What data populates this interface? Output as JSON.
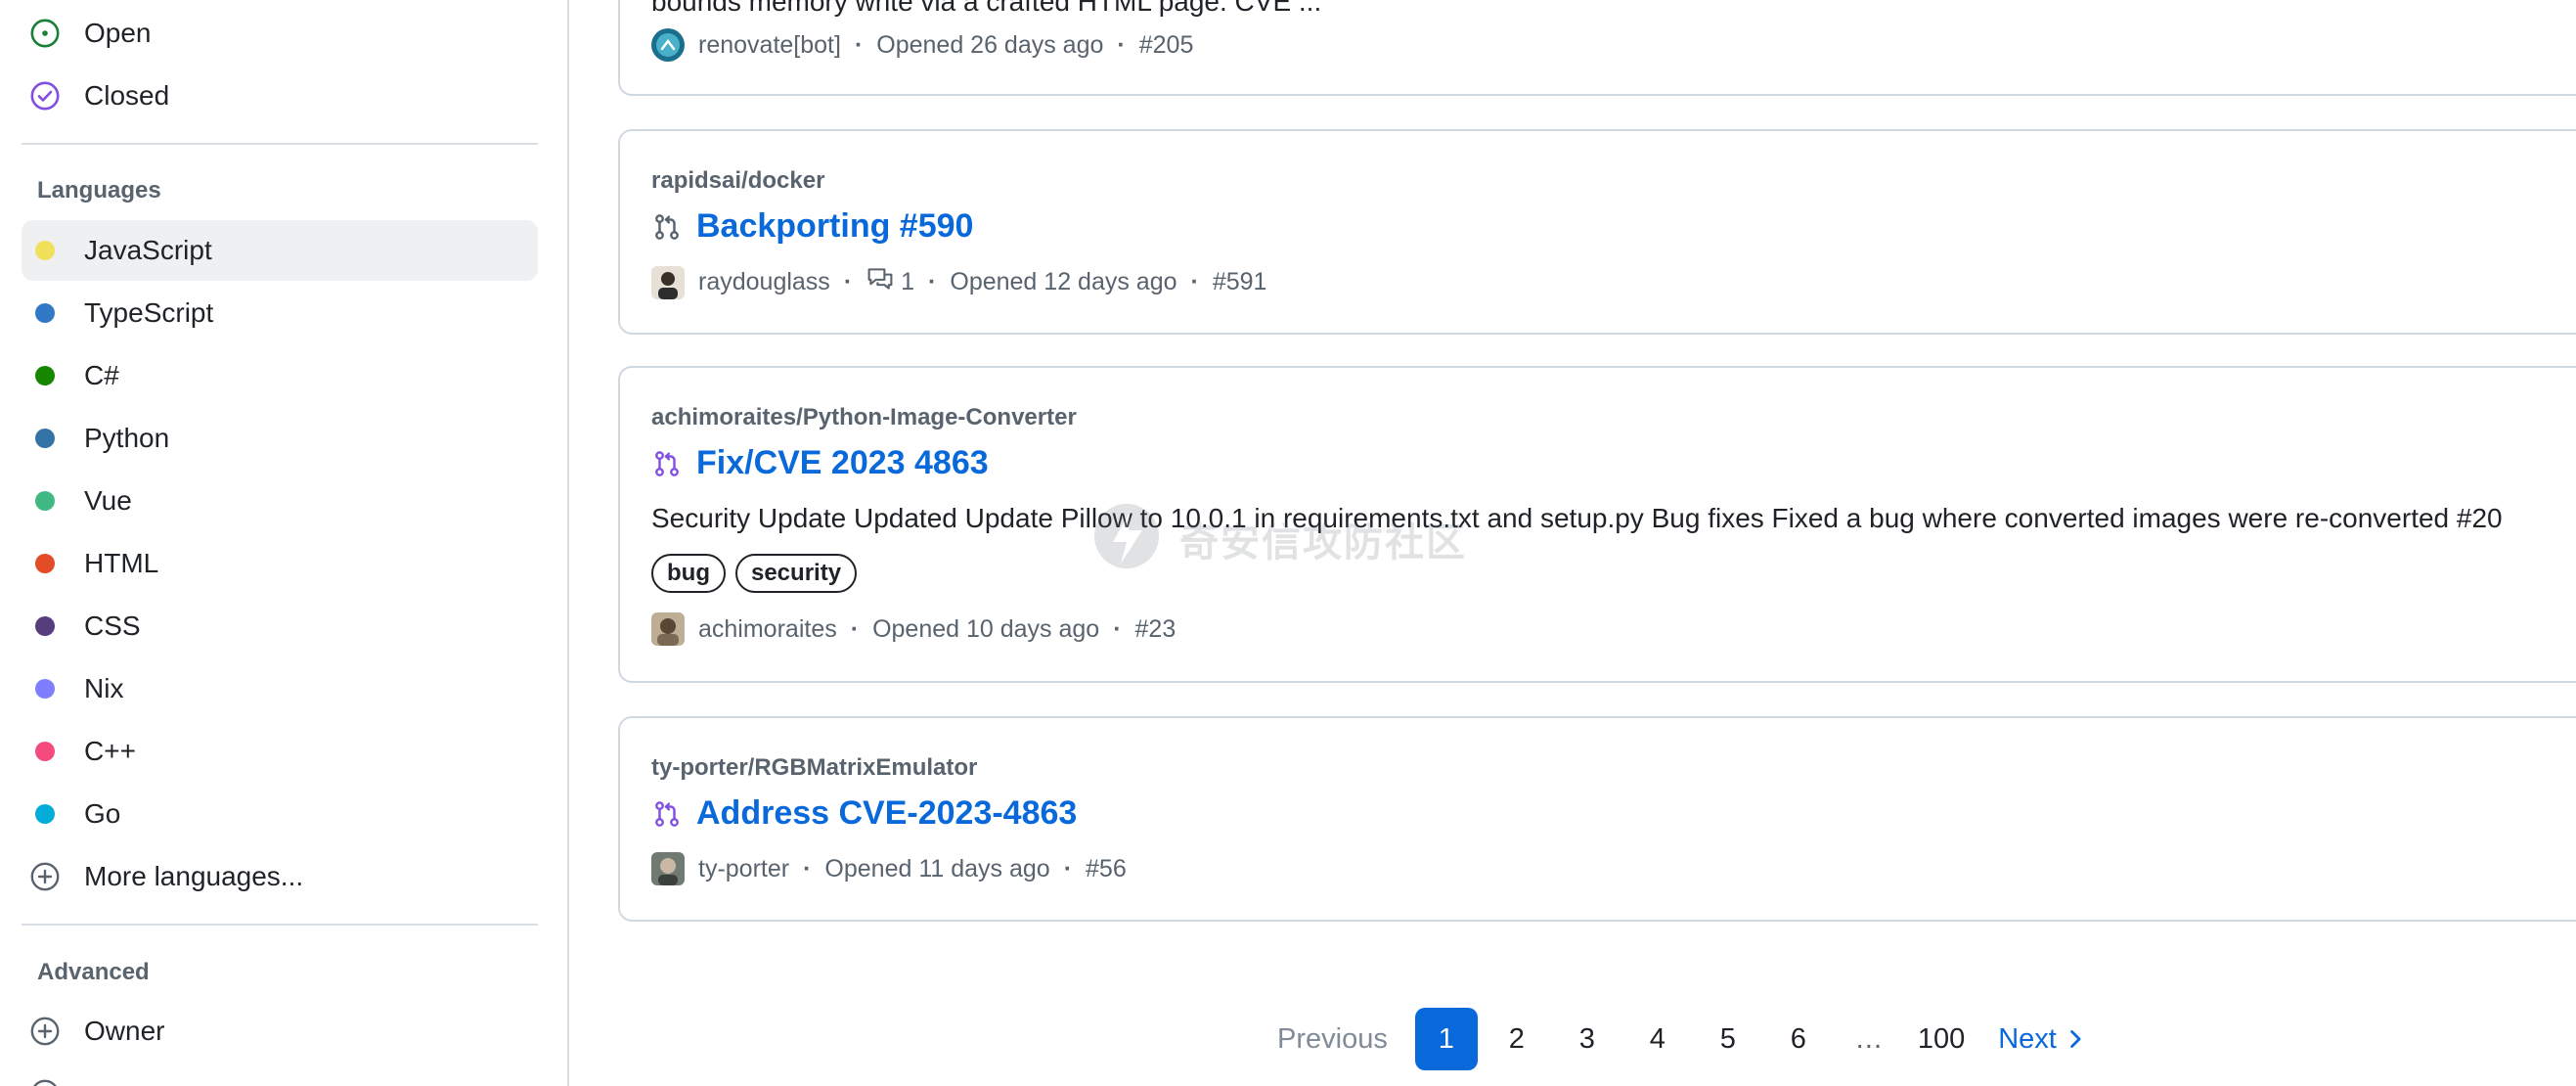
{
  "sidebar": {
    "state_filters": [
      {
        "label": "Open",
        "icon": "issue-open-icon",
        "color": "#1a7f37"
      },
      {
        "label": "Closed",
        "icon": "check-circle-icon",
        "color": "#8250df"
      }
    ],
    "languages_heading": "Languages",
    "languages": [
      {
        "label": "JavaScript",
        "color": "#f1e05a",
        "selected": true
      },
      {
        "label": "TypeScript",
        "color": "#3178c6"
      },
      {
        "label": "C#",
        "color": "#178600"
      },
      {
        "label": "Python",
        "color": "#3572a5"
      },
      {
        "label": "Vue",
        "color": "#41b883"
      },
      {
        "label": "HTML",
        "color": "#e34c26"
      },
      {
        "label": "CSS",
        "color": "#563d7c"
      },
      {
        "label": "Nix",
        "color": "#7e7eff"
      },
      {
        "label": "C++",
        "color": "#f34b7d"
      },
      {
        "label": "Go",
        "color": "#00add8"
      }
    ],
    "more_languages": "More languages...",
    "advanced_heading": "Advanced",
    "advanced": [
      {
        "label": "Owner",
        "icon": "plus-circle-icon"
      }
    ]
  },
  "results": [
    {
      "repo": "",
      "title": "",
      "description": "bounds memory write via a crafted HTML page. CVE ...",
      "author": "renovate[bot]",
      "opened": "Opened 26 days ago",
      "number": "#205"
    },
    {
      "repo": "rapidsai/docker",
      "title": "Backporting #590",
      "author": "raydouglass",
      "comments": "1",
      "opened": "Opened 12 days ago",
      "number": "#591"
    },
    {
      "repo": "achimoraites/Python-Image-Converter",
      "title": "Fix/CVE 2023 4863",
      "description": "Security Update Updated Update Pillow to 10.0.1 in requirements.txt and setup.py Bug fixes Fixed a bug where converted images were re-converted #20",
      "labels": [
        "bug",
        "security"
      ],
      "author": "achimoraites",
      "opened": "Opened 10 days ago",
      "number": "#23"
    },
    {
      "repo": "ty-porter/RGBMatrixEmulator",
      "title": "Address CVE-2023-4863",
      "author": "ty-porter",
      "opened": "Opened 11 days ago",
      "number": "#56"
    }
  ],
  "watermark": "奇安信攻防社区",
  "pagination": {
    "previous": "Previous",
    "pages": [
      "1",
      "2",
      "3",
      "4",
      "5",
      "6"
    ],
    "ellipsis": "…",
    "last": "100",
    "next": "Next",
    "current": "1"
  }
}
